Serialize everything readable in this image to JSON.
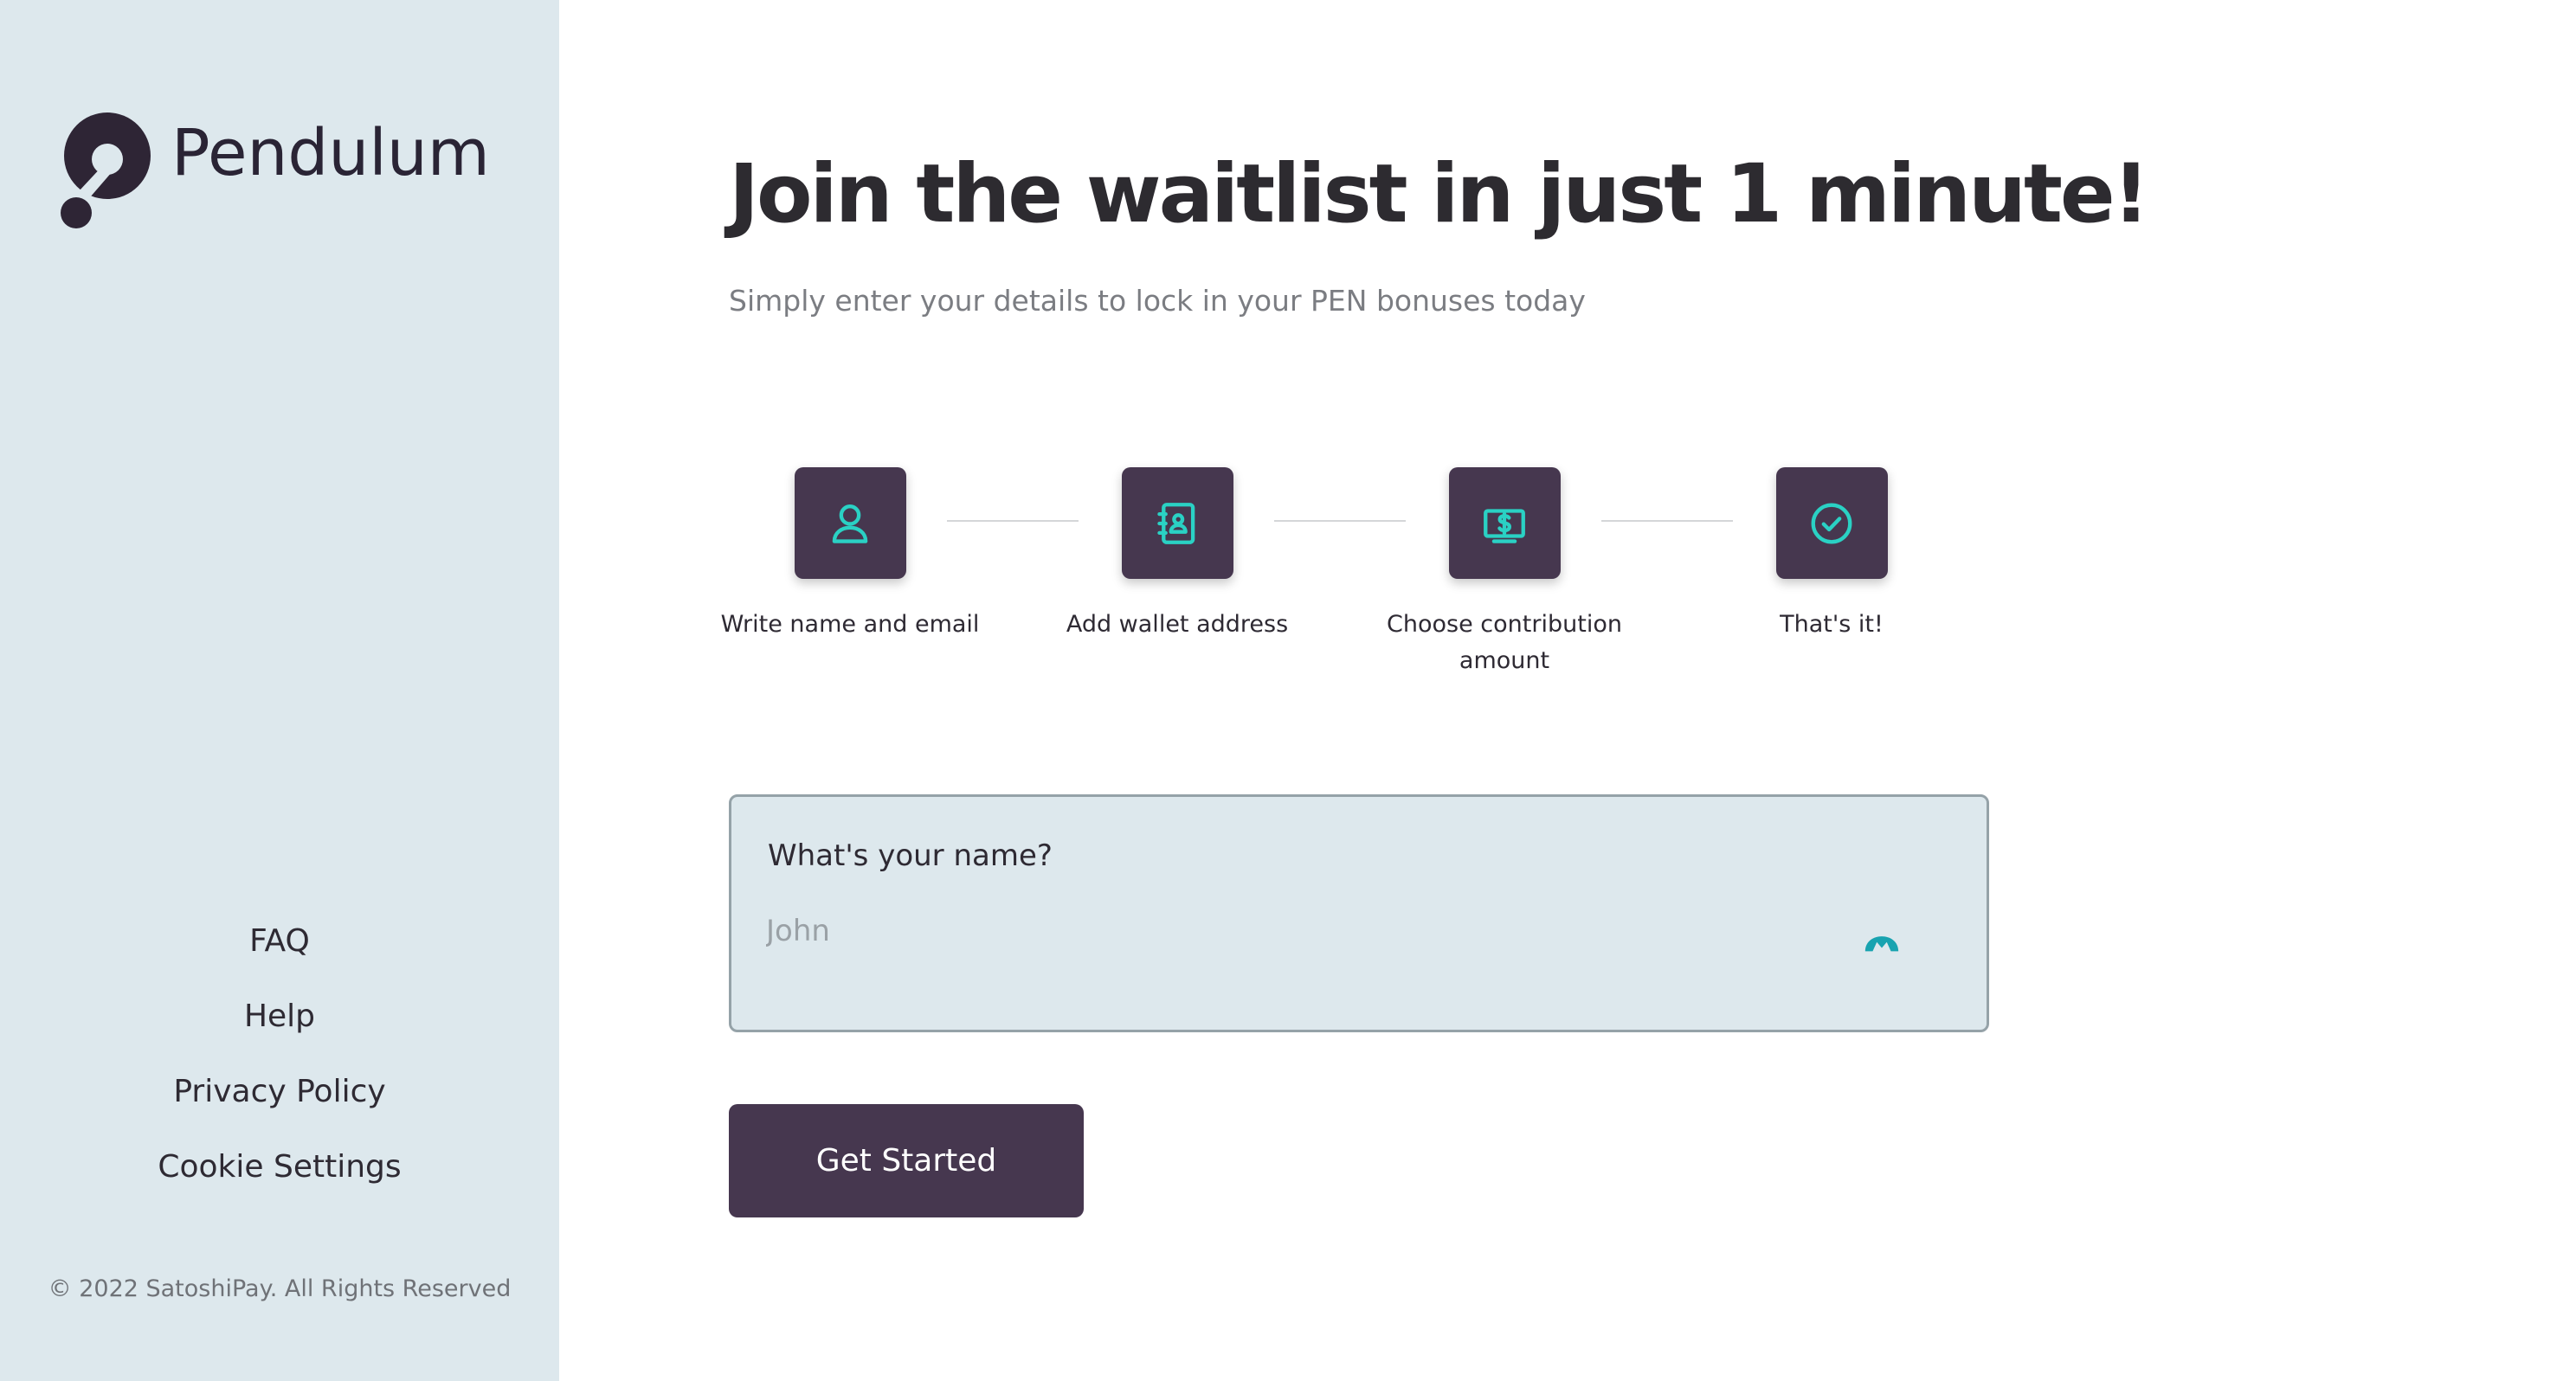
{
  "brand": {
    "name": "Pendulum",
    "primary_color": "#46374f",
    "accent_color": "#2ad1c4",
    "sidebar_color": "#dde8ed"
  },
  "sidebar": {
    "links": [
      {
        "label": "FAQ"
      },
      {
        "label": "Help"
      },
      {
        "label": "Privacy Policy"
      },
      {
        "label": "Cookie Settings"
      }
    ],
    "copyright": "© 2022 SatoshiPay. All Rights Reserved"
  },
  "main": {
    "title": "Join the waitlist in just 1 minute!",
    "subtitle": "Simply enter your details to lock in your PEN bonuses today",
    "steps": [
      {
        "label": "Write name and email",
        "icon": "user-icon"
      },
      {
        "label": "Add wallet address",
        "icon": "contact-book-icon"
      },
      {
        "label": "Choose contribution amount",
        "icon": "dollar-bill-icon"
      },
      {
        "label": "That's it!",
        "icon": "check-circle-icon"
      }
    ],
    "form": {
      "label": "What's your name?",
      "value": "",
      "placeholder": "John",
      "badge_icon": "password-manager-icon"
    },
    "cta_label": "Get Started"
  }
}
